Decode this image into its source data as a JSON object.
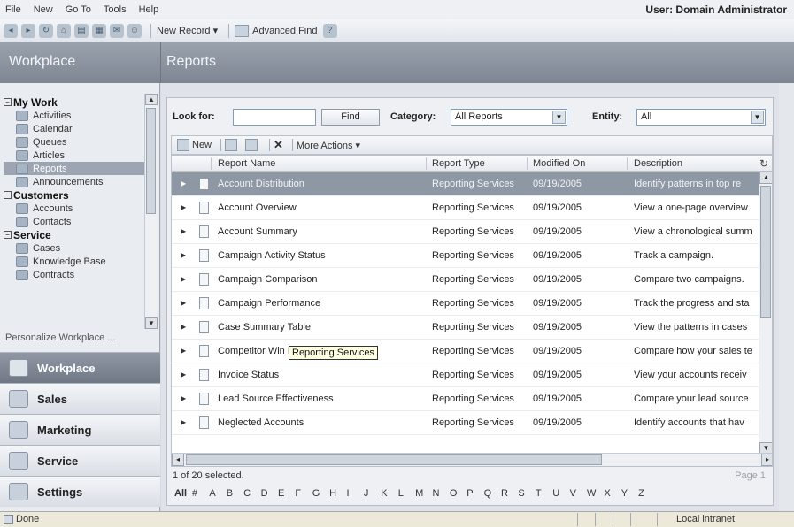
{
  "menu": {
    "items": [
      "File",
      "New",
      "Go To",
      "Tools",
      "Help"
    ],
    "user_label": "User: Domain Administrator"
  },
  "toolbar": {
    "new_record": "New Record ▾",
    "advanced_find": "Advanced Find"
  },
  "titlebar": {
    "left_title": "Workplace",
    "right_title": "Reports"
  },
  "sidebar": {
    "groups": [
      {
        "label": "My Work",
        "items": [
          "Activities",
          "Calendar",
          "Queues",
          "Articles",
          "Reports",
          "Announcements"
        ]
      },
      {
        "label": "Customers",
        "items": [
          "Accounts",
          "Contacts"
        ]
      },
      {
        "label": "Service",
        "items": [
          "Cases",
          "Knowledge Base",
          "Contracts"
        ]
      }
    ],
    "active_item": "Reports",
    "personalize": "Personalize Workplace ...",
    "wunderbar": [
      "Workplace",
      "Sales",
      "Marketing",
      "Service",
      "Settings"
    ],
    "active_wunderbar": "Workplace"
  },
  "search": {
    "look_for_label": "Look for:",
    "look_for_value": "",
    "find_label": "Find",
    "category_label": "Category:",
    "category_value": "All Reports",
    "entity_label": "Entity:",
    "entity_value": "All"
  },
  "gridbar": {
    "new": "New",
    "more_actions": "More Actions ▾"
  },
  "grid": {
    "columns": [
      "Report Name",
      "Report Type",
      "Modified On",
      "Description"
    ],
    "rows": [
      {
        "name": "Account Distribution",
        "type": "Reporting Services",
        "modified": "09/19/2005",
        "desc": "Identify patterns in top re",
        "selected": true
      },
      {
        "name": "Account Overview",
        "type": "Reporting Services",
        "modified": "09/19/2005",
        "desc": "View a one-page overview"
      },
      {
        "name": "Account Summary",
        "type": "Reporting Services",
        "modified": "09/19/2005",
        "desc": "View a chronological summ"
      },
      {
        "name": "Campaign Activity Status",
        "type": "Reporting Services",
        "modified": "09/19/2005",
        "desc": "Track a campaign."
      },
      {
        "name": "Campaign Comparison",
        "type": "Reporting Services",
        "modified": "09/19/2005",
        "desc": "Compare two campaigns."
      },
      {
        "name": "Campaign Performance",
        "type": "Reporting Services",
        "modified": "09/19/2005",
        "desc": "Track the progress and sta"
      },
      {
        "name": "Case Summary Table",
        "type": "Reporting Services",
        "modified": "09/19/2005",
        "desc": "View the patterns in cases"
      },
      {
        "name": "Competitor Win Loss",
        "type": "Reporting Services",
        "modified": "09/19/2005",
        "desc": "Compare how your sales te"
      },
      {
        "name": "Invoice Status",
        "type": "Reporting Services",
        "modified": "09/19/2005",
        "desc": "View your accounts receiv"
      },
      {
        "name": "Lead Source Effectiveness",
        "type": "Reporting Services",
        "modified": "09/19/2005",
        "desc": "Compare your lead source"
      },
      {
        "name": "Neglected Accounts",
        "type": "Reporting Services",
        "modified": "09/19/2005",
        "desc": "Identify accounts that hav"
      }
    ],
    "tooltip": "Reporting Services"
  },
  "footer": {
    "selected": "1 of 20 selected.",
    "page": "Page 1",
    "alpha": [
      "All",
      "#",
      "A",
      "B",
      "C",
      "D",
      "E",
      "F",
      "G",
      "H",
      "I",
      "J",
      "K",
      "L",
      "M",
      "N",
      "O",
      "P",
      "Q",
      "R",
      "S",
      "T",
      "U",
      "V",
      "W",
      "X",
      "Y",
      "Z"
    ]
  },
  "statusbar": {
    "status": "Done",
    "zone": "Local intranet"
  },
  "colors": {
    "title_bar": "#8a929d",
    "selected_row": "#8e98a4"
  }
}
